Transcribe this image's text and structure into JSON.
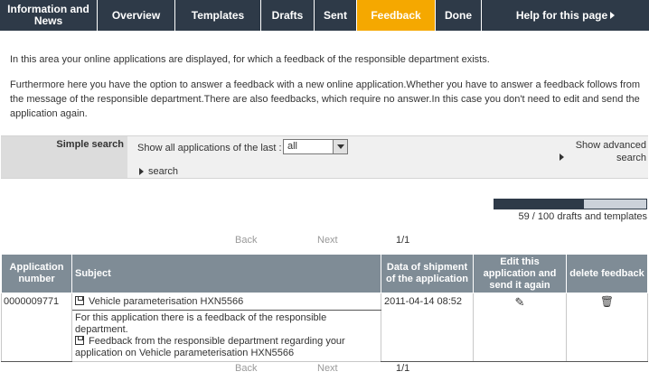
{
  "nav": {
    "items": [
      {
        "label": "Information and News"
      },
      {
        "label": "Overview"
      },
      {
        "label": "Templates"
      },
      {
        "label": "Drafts"
      },
      {
        "label": "Sent"
      },
      {
        "label": "Feedback",
        "active": true
      },
      {
        "label": "Done"
      }
    ],
    "help": "Help for this page"
  },
  "intro": {
    "p1": "In this area your online applications are displayed, for which a feedback of the responsible department exists.",
    "p2": "Furthermore here you have the option to answer a feedback with a new online application.Whether you have to answer a feedback follows from the message of the responsible department.There are also feedbacks, which require no answer.In this case you don't need to edit and send the application again."
  },
  "search": {
    "label": "Simple search",
    "show_label": "Show all applications of the last :",
    "select_value": "all",
    "search_link": "search",
    "advanced_link": "Show advanced search"
  },
  "progress": {
    "fraction": 0.59,
    "text": "59 / 100 drafts and templates"
  },
  "pager": {
    "back": "Back",
    "next": "Next",
    "page": "1/1"
  },
  "table": {
    "headers": {
      "app_number": "Application number",
      "subject": "Subject",
      "date": "Data of shipment of the application",
      "edit": "Edit this application and send it again",
      "delete": "delete feedback"
    },
    "rows": [
      {
        "app_number": "0000009771",
        "subject": "Vehicle parameterisation HXN5566",
        "date": "2011-04-14 08:52",
        "desc_line1": "For this application there is a feedback of the responsible department.",
        "desc_line2": "Feedback from the responsible department regarding your application on Vehicle parameterisation HXN5566"
      }
    ]
  },
  "colors": {
    "nav_bg": "#2e3a48",
    "active_tab": "#f5a800",
    "table_header": "#7f8c96"
  }
}
